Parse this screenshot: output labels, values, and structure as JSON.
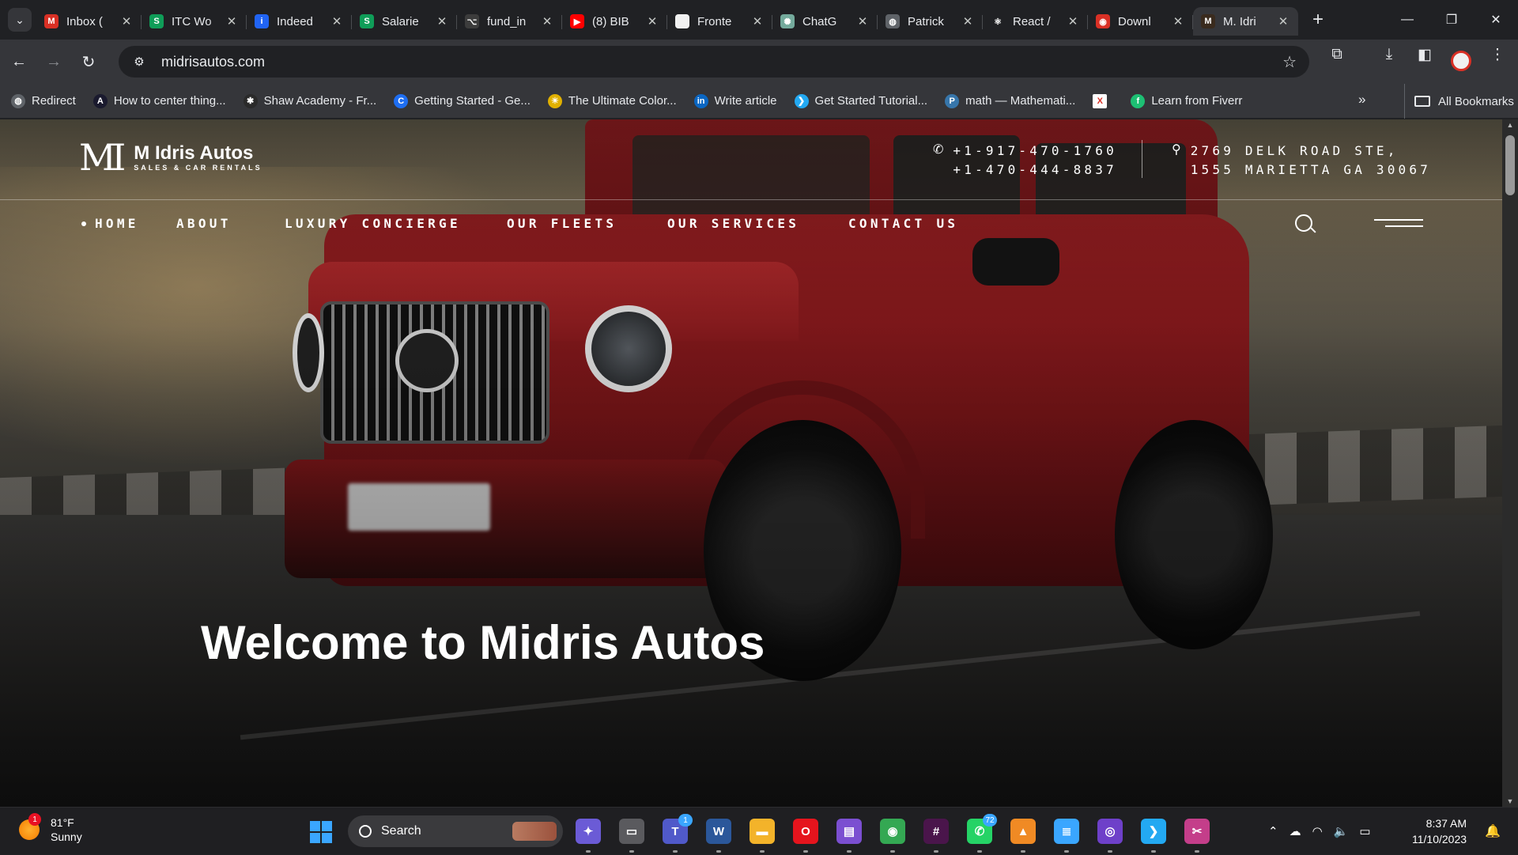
{
  "browser": {
    "tabs": [
      {
        "title": "Inbox (",
        "favicon": "gmail-icon",
        "color": "#d93025",
        "glyph": "M",
        "active": false
      },
      {
        "title": "ITC Wo",
        "favicon": "sheets-icon",
        "color": "#0f9d58",
        "glyph": "S",
        "active": false
      },
      {
        "title": "Indeed",
        "favicon": "indeed-icon",
        "color": "#2164f3",
        "glyph": "i",
        "active": false
      },
      {
        "title": "Salarie",
        "favicon": "sheets-icon",
        "color": "#0f9d58",
        "glyph": "S",
        "active": false
      },
      {
        "title": "fund_in",
        "favicon": "github-icon",
        "color": "#3c3c3c",
        "glyph": "⌥",
        "active": false
      },
      {
        "title": "(8) BIB",
        "favicon": "youtube-icon",
        "color": "#ff0000",
        "glyph": "▶",
        "active": false
      },
      {
        "title": "Fronte",
        "favicon": "page-icon",
        "color": "#f1f1f1",
        "glyph": "",
        "active": false
      },
      {
        "title": "ChatG",
        "favicon": "chatgpt-icon",
        "color": "#74aa9c",
        "glyph": "✺",
        "active": false
      },
      {
        "title": "Patrick",
        "favicon": "globe-icon",
        "color": "#5f6368",
        "glyph": "◍",
        "active": false
      },
      {
        "title": "React /",
        "favicon": "react-icon",
        "color": "#202124",
        "glyph": "⚛",
        "active": false
      },
      {
        "title": "Downl",
        "favicon": "download-site-icon",
        "color": "#d93025",
        "glyph": "◉",
        "active": false
      },
      {
        "title": "M. Idri",
        "favicon": "midris-icon",
        "color": "#3a2b1e",
        "glyph": "M",
        "active": true
      }
    ],
    "new_tab_label": "+",
    "url": "midrisautos.com",
    "bookmarks": [
      {
        "label": "Redirect",
        "icon": "globe-icon",
        "color": "#5f6368",
        "glyph": "◍"
      },
      {
        "label": "How to center thing...",
        "icon": "angular-icon",
        "color": "#1a1a2e",
        "glyph": "A"
      },
      {
        "label": "Shaw Academy - Fr...",
        "icon": "shaw-icon",
        "color": "#2a2a2a",
        "glyph": "✱"
      },
      {
        "label": "Getting Started - Ge...",
        "icon": "c-icon",
        "color": "#1e6ef2",
        "glyph": "C"
      },
      {
        "label": "The Ultimate Color...",
        "icon": "color-icon",
        "color": "#e0b000",
        "glyph": "☀"
      },
      {
        "label": "Write article",
        "icon": "linkedin-icon",
        "color": "#0a66c2",
        "glyph": "in"
      },
      {
        "label": "Get Started Tutorial...",
        "icon": "vscode-icon",
        "color": "#23a9f2",
        "glyph": "❯"
      },
      {
        "label": "math — Mathemati...",
        "icon": "python-icon",
        "color": "#3776ab",
        "glyph": "P"
      },
      {
        "label": "",
        "icon": "x-site-icon",
        "color": "#ffffff",
        "glyph": "X"
      },
      {
        "label": "Learn from Fiverr",
        "icon": "fiverr-icon",
        "color": "#1dbf73",
        "glyph": "f"
      }
    ],
    "all_bookmarks_label": "All Bookmarks"
  },
  "site": {
    "logo_mark": "MI",
    "logo_name": "M Idris Autos",
    "logo_tagline": "SALES & CAR RENTALS",
    "phone_1": "+1-917-470-1760",
    "phone_2": "+1-470-444-8837",
    "address_1": "2769 DELK ROAD STE,",
    "address_2": "1555 MARIETTA GA 30067",
    "nav": [
      "HOME",
      "ABOUT",
      "LUXURY CONCIERGE",
      "OUR FLEETS",
      "OUR SERVICES",
      "CONTACT US"
    ],
    "hero_title": "Welcome to Midris Autos"
  },
  "taskbar": {
    "weather_temp": "81°F",
    "weather_desc": "Sunny",
    "weather_badge": "1",
    "search_label": "Search",
    "apps": [
      {
        "name": "copilot-icon",
        "color": "#6b5bd6",
        "glyph": "✦",
        "badge": ""
      },
      {
        "name": "task-view-icon",
        "color": "#5a5a5e",
        "glyph": "▭",
        "badge": ""
      },
      {
        "name": "teams-icon",
        "color": "#5059c9",
        "glyph": "T",
        "badge": "1"
      },
      {
        "name": "word-icon",
        "color": "#2b579a",
        "glyph": "W",
        "badge": ""
      },
      {
        "name": "file-explorer-icon",
        "color": "#f3b32a",
        "glyph": "▬",
        "badge": ""
      },
      {
        "name": "opera-icon",
        "color": "#e5141d",
        "glyph": "O",
        "badge": ""
      },
      {
        "name": "clipchamp-icon",
        "color": "#7b4fd1",
        "glyph": "▤",
        "badge": ""
      },
      {
        "name": "chrome-icon",
        "color": "#34a853",
        "glyph": "◉",
        "badge": ""
      },
      {
        "name": "slack-icon",
        "color": "#4a154b",
        "glyph": "#",
        "badge": ""
      },
      {
        "name": "whatsapp-icon",
        "color": "#25d366",
        "glyph": "✆",
        "badge": "72"
      },
      {
        "name": "vlc-icon",
        "color": "#f08a24",
        "glyph": "▲",
        "badge": ""
      },
      {
        "name": "notepad-icon",
        "color": "#3aa6ff",
        "glyph": "≣",
        "badge": ""
      },
      {
        "name": "github-desktop-icon",
        "color": "#6e40c9",
        "glyph": "◎",
        "badge": ""
      },
      {
        "name": "vscode-icon",
        "color": "#23a9f2",
        "glyph": "❯",
        "badge": ""
      },
      {
        "name": "snipping-tool-icon",
        "color": "#c43e8a",
        "glyph": "✂",
        "badge": ""
      }
    ],
    "time": "8:37 AM",
    "date": "11/10/2023"
  }
}
